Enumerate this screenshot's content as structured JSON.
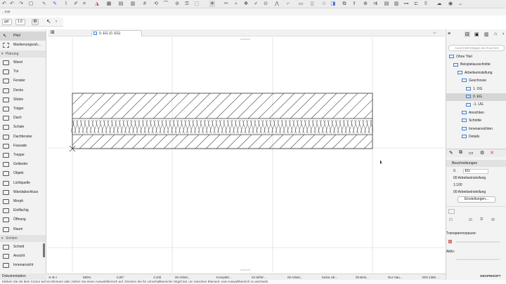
{
  "toolbar": {
    "top_label": "...mat"
  },
  "options_bar": {
    "field1": "gst",
    "field2": "1.0"
  },
  "toolbox": {
    "items": [
      {
        "label": "Pfeil",
        "selected": true,
        "icon": "arrow-icon"
      },
      {
        "label": "Markierungsrah...",
        "icon": "marquee-icon"
      }
    ],
    "group_planung": "Planung",
    "planung_items": [
      {
        "label": "Wand",
        "icon": "wall-icon"
      },
      {
        "label": "Tür",
        "icon": "door-icon"
      },
      {
        "label": "Fenster",
        "icon": "window-icon"
      },
      {
        "label": "Decke",
        "icon": "slab-icon"
      },
      {
        "label": "Stütze",
        "icon": "column-icon"
      },
      {
        "label": "Träger",
        "icon": "beam-icon"
      },
      {
        "label": "Dach",
        "icon": "roof-icon"
      },
      {
        "label": "Schale",
        "icon": "shell-icon"
      },
      {
        "label": "Dachfenster",
        "icon": "skylight-icon"
      },
      {
        "label": "Fassade",
        "icon": "curtainwall-icon"
      },
      {
        "label": "Treppe",
        "icon": "stair-icon"
      },
      {
        "label": "Geländer",
        "icon": "railing-icon"
      },
      {
        "label": "Objekt",
        "icon": "object-icon"
      },
      {
        "label": "Lichtquelle",
        "icon": "lamp-icon"
      },
      {
        "label": "Wandabschluss",
        "icon": "wallend-icon"
      },
      {
        "label": "Morph",
        "icon": "morph-icon"
      },
      {
        "label": "Einflächig",
        "icon": "zone-icon"
      },
      {
        "label": "Öffnung",
        "icon": "opening-icon"
      },
      {
        "label": "Raum",
        "icon": "room-icon"
      }
    ],
    "group_sichten": "Sichten",
    "sichten_items": [
      {
        "label": "Schnitt",
        "icon": "section-icon"
      },
      {
        "label": "Ansicht",
        "icon": "elevation-icon"
      },
      {
        "label": "Innenansicht",
        "icon": "interior-icon"
      }
    ],
    "footer": "Dokumentation"
  },
  "canvas": {
    "tab_label": "0. EG (0. EG)"
  },
  "statusbar": {
    "zoom": "590%",
    "angle": "0,00°",
    "scale": "1:100",
    "items": [
      "00 Arbeit...",
      "Komplett...",
      "04 Sil/W ...",
      "00 Arbeit...",
      "Keine Ub...",
      "00 Beis...",
      "Nur Hau...",
      "DIN 1356 ..."
    ]
  },
  "hint": "Klicken Sie mit dem Cursor auf ein Element oder ziehen Sie einen Auswahlbereich auf. Drücken Sie für Umschaltbereiche Strg/Cmd, um zwischen Element- und Auswahlbereich zu wechseln.",
  "navigator": {
    "search_placeholder": "Ausschnitt-Mappe durchsuchen",
    "tree": [
      {
        "label": "Ohne Titel",
        "indent": 0
      },
      {
        "label": "Beispielausschnitte",
        "indent": 1
      },
      {
        "label": "Arbeitseinstellung",
        "indent": 2
      },
      {
        "label": "Geschosse",
        "indent": 3
      },
      {
        "label": "1. OG",
        "indent": 4
      },
      {
        "label": "0. EG",
        "indent": 4,
        "selected": true
      },
      {
        "label": "-1. UG",
        "indent": 4
      },
      {
        "label": "Ansichten",
        "indent": 3
      },
      {
        "label": "Schnitte",
        "indent": 3
      },
      {
        "label": "Innenansichten",
        "indent": 3
      },
      {
        "label": "Details",
        "indent": 3
      }
    ],
    "props_header": "Beschreibungen",
    "props": {
      "id": "0.",
      "name": "EG",
      "layer_combo": "00 Arbeitseinstellung",
      "scale": "1:100",
      "model_view": "00 Arbeitseinstellung",
      "settings_button": "Einstellungen..."
    },
    "section_transparent": "Transparenzpause:",
    "section_active": "Aktiv:",
    "brand": "GRAPHISOFT"
  }
}
